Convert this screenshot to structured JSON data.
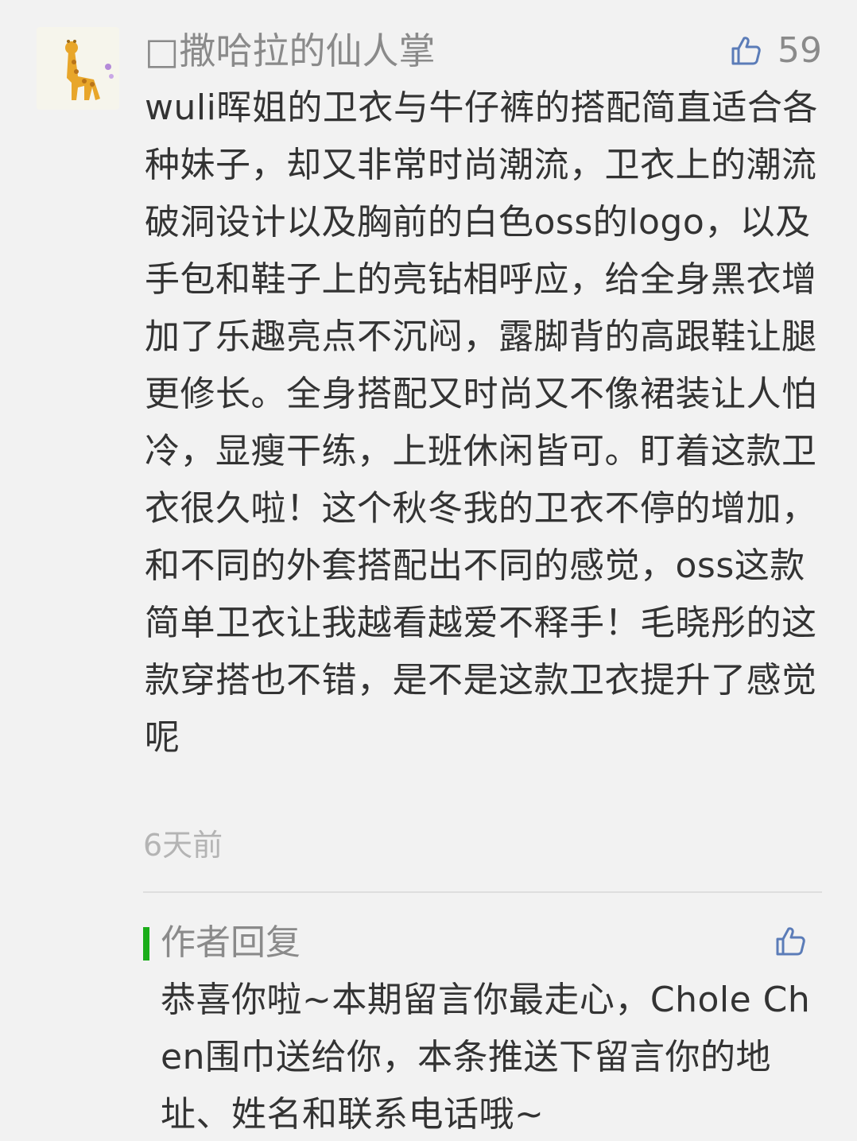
{
  "comment": {
    "avatar_icon": "giraffe-avatar-icon",
    "nickname": "□撒哈拉的仙人掌",
    "like_icon": "thumbs-up-icon",
    "like_count": "59",
    "text": "wuli晖姐的卫衣与牛仔裤的搭配简直适合各种妹子，却又非常时尚潮流，卫衣上的潮流破洞设计以及胸前的白色oss的logo，以及手包和鞋子上的亮钻相呼应，给全身黑衣增加了乐趣亮点不沉闷，露脚背的高跟鞋让腿更修长。全身搭配又时尚又不像裙装让人怕冷，显瘦干练，上班休闲皆可。盯着这款卫衣很久啦！这个秋冬我的卫衣不停的增加，和不同的外套搭配出不同的感觉，oss这款简单卫衣让我越看越爱不释手！毛晓彤的这款穿搭也不错，是不是这款卫衣提升了感觉呢",
    "time": "6天前"
  },
  "reply": {
    "title": "作者回复",
    "accent_color": "#1aad19",
    "like_icon": "thumbs-up-icon",
    "text": "恭喜你啦~本期留言你最走心，Chole Chen围巾送给你，本条推送下留言你的地址、姓名和联系电话哦~"
  }
}
